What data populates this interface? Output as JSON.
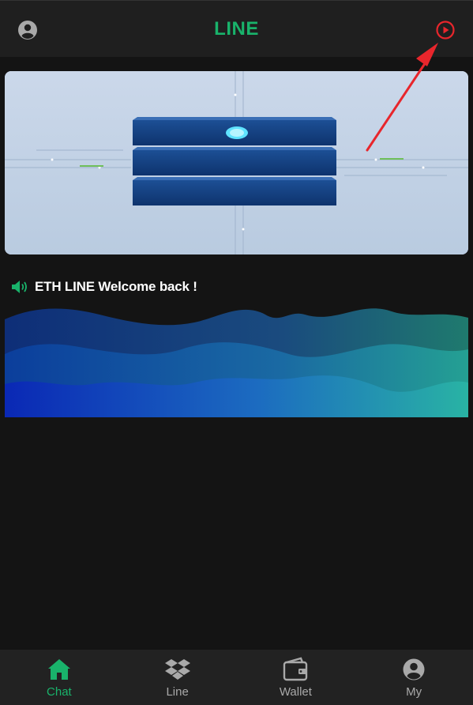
{
  "header": {
    "title": "LINE",
    "avatar_icon": "user-circle-icon",
    "action_icon": "play-circle-icon"
  },
  "notice": {
    "icon": "speaker-icon",
    "text": "ETH LINE Welcome back !"
  },
  "tabs": [
    {
      "label": "Chat",
      "icon": "home-icon",
      "active": true
    },
    {
      "label": "Line",
      "icon": "dropbox-icon",
      "active": false
    },
    {
      "label": "Wallet",
      "icon": "wallet-icon",
      "active": false
    },
    {
      "label": "My",
      "icon": "user-circle-icon",
      "active": false
    }
  ],
  "colors": {
    "accent": "#19b36b",
    "background": "#141414",
    "header": "#1f1f1f",
    "tabbar": "#222222",
    "annotation_arrow": "#e8262c"
  }
}
